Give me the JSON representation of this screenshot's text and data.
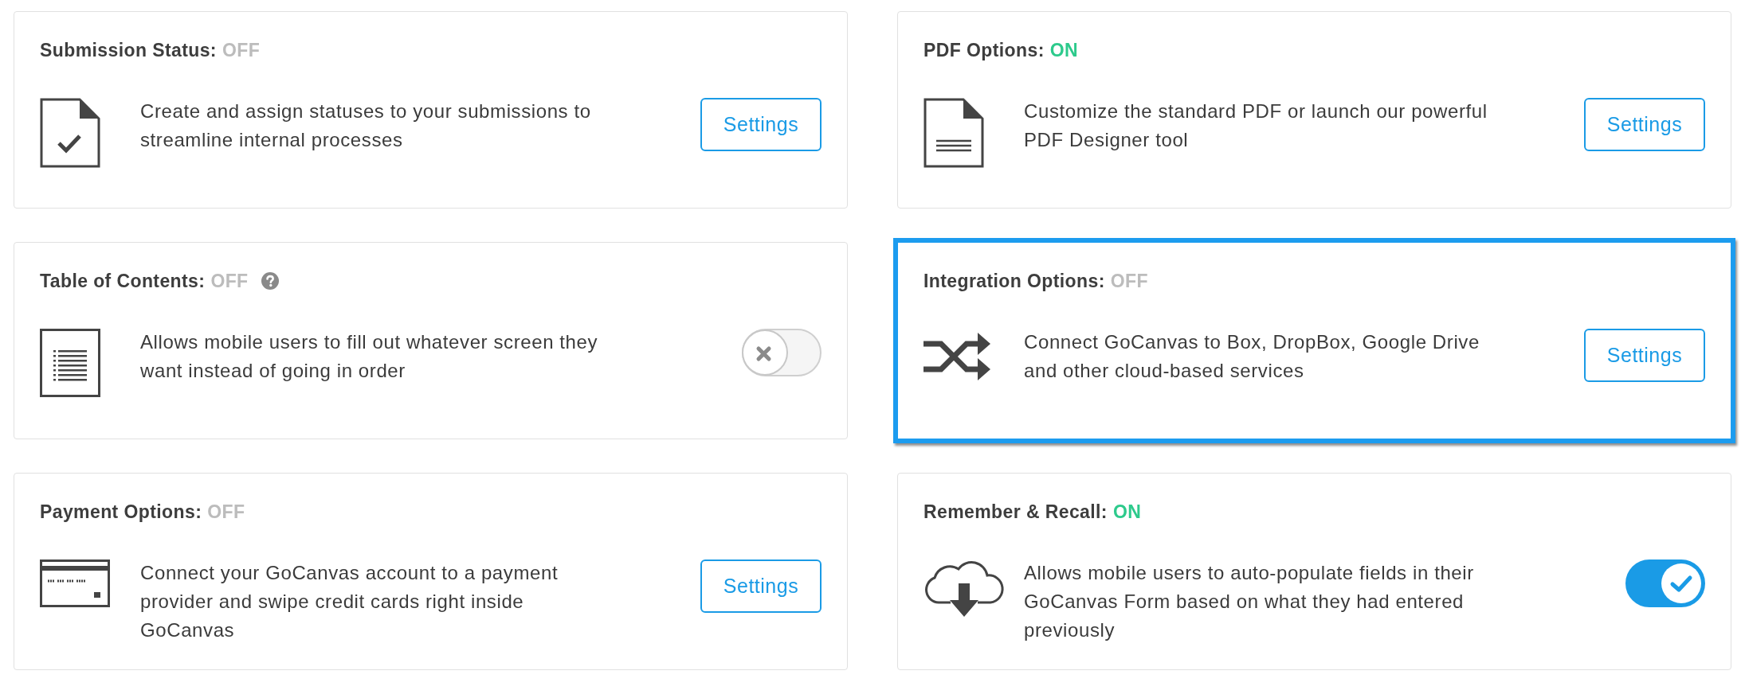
{
  "cards": [
    {
      "title": "Submission Status:",
      "status": "OFF",
      "on": false,
      "highlighted": false,
      "description": "Create and assign statuses to your submissions to streamline internal processes",
      "control": {
        "kind": "button",
        "label": "Settings"
      }
    },
    {
      "title": "PDF Options:",
      "status": "ON",
      "on": true,
      "highlighted": false,
      "description": "Customize the standard PDF or launch our powerful PDF Designer tool",
      "control": {
        "kind": "button",
        "label": "Settings"
      }
    },
    {
      "title": "Table of Contents:",
      "status": "OFF",
      "on": false,
      "help": true,
      "highlighted": false,
      "description": "Allows mobile users to fill out whatever screen they want instead of going in order",
      "control": {
        "kind": "toggle",
        "on": false
      }
    },
    {
      "title": "Integration Options:",
      "status": "OFF",
      "on": false,
      "highlighted": true,
      "description": "Connect GoCanvas to Box, DropBox, Google Drive and other cloud-based services",
      "control": {
        "kind": "button",
        "label": "Settings"
      }
    },
    {
      "title": "Payment Options:",
      "status": "OFF",
      "on": false,
      "highlighted": false,
      "description": "Connect your GoCanvas account to a payment provider and swipe credit cards right inside GoCanvas",
      "control": {
        "kind": "button",
        "label": "Settings"
      }
    },
    {
      "title": "Remember & Recall:",
      "status": "ON",
      "on": true,
      "highlighted": false,
      "description": "Allows mobile users to auto-populate fields in their GoCanvas Form based on what they had entered previously",
      "control": {
        "kind": "toggle",
        "on": true
      }
    }
  ]
}
